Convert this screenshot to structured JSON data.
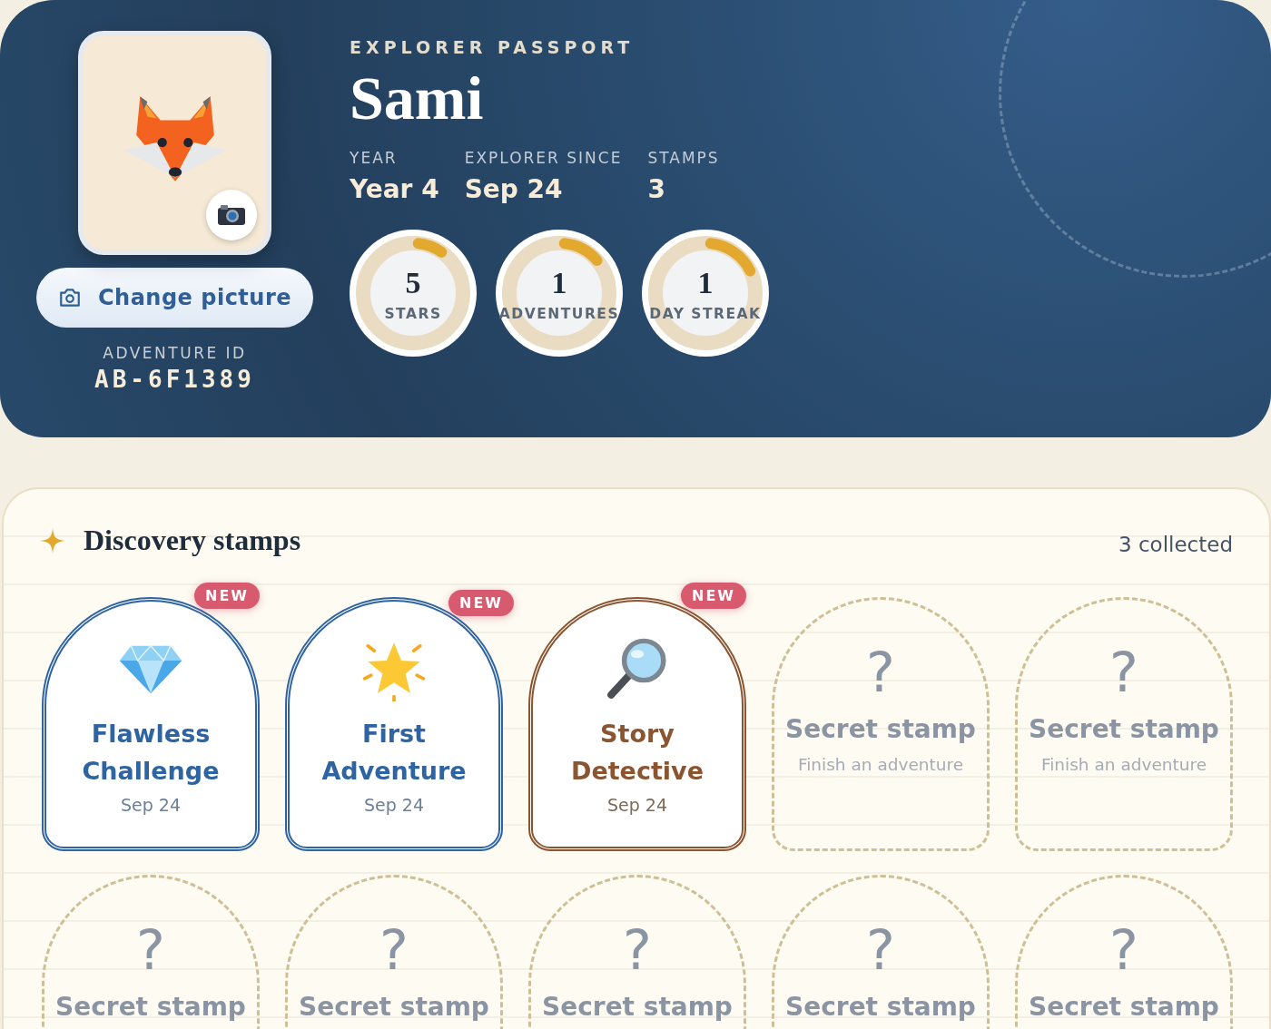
{
  "passport": {
    "eyebrow": "EXPLORER PASSPORT",
    "name": "Sami",
    "avatar_button": "Change picture",
    "id_label": "ADVENTURE ID",
    "id_value": "AB-6F1389",
    "stats": [
      {
        "label": "YEAR",
        "value": "Year 4"
      },
      {
        "label": "EXPLORER SINCE",
        "value": "Sep 24"
      },
      {
        "label": "STAMPS",
        "value": "3"
      }
    ],
    "rings": [
      {
        "value": "5",
        "label": "STARS",
        "level": 0.08
      },
      {
        "value": "1",
        "label": "ADVENTURES",
        "level": 0.12
      },
      {
        "value": "1",
        "label": "DAY STREAK",
        "level": 0.16
      }
    ]
  },
  "stamps": {
    "title": "Discovery stamps",
    "count": "3 collected",
    "items": [
      {
        "kind": "collected",
        "title": "Flawless Challenge",
        "date": "Sep 24",
        "color": "#2f64a3",
        "badge": "NEW"
      },
      {
        "kind": "collected",
        "title": "First Adventure",
        "date": "Sep 24",
        "color": "#2f64a3",
        "badge": "NEW"
      },
      {
        "kind": "collected",
        "title": "Story Detective",
        "date": "Sep 24",
        "color": "#8a5530",
        "badge": "NEW"
      },
      {
        "kind": "secret",
        "mark": "?",
        "title": "Secret stamp",
        "hint": "Finish an adventure"
      },
      {
        "kind": "secret",
        "mark": "?",
        "title": "Secret stamp",
        "hint": "Finish an adventure"
      },
      {
        "kind": "secret",
        "mark": "?",
        "title": "Secret stamp"
      },
      {
        "kind": "secret",
        "mark": "?",
        "title": "Secret stamp"
      },
      {
        "kind": "secret",
        "mark": "?",
        "title": "Secret stamp"
      },
      {
        "kind": "secret",
        "mark": "?",
        "title": "Secret stamp"
      },
      {
        "kind": "secret",
        "mark": "?",
        "title": "Secret stamp"
      }
    ]
  }
}
